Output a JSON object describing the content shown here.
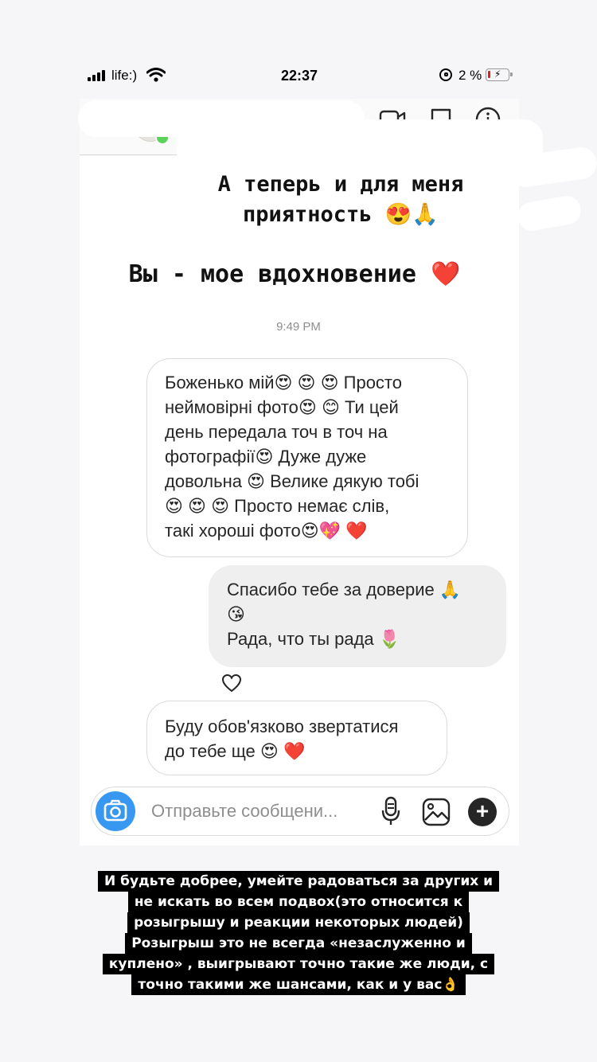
{
  "status_bar": {
    "carrier": "life:)",
    "time": "22:37",
    "battery": "2 %"
  },
  "story": {
    "top_line1": "А теперь и для меня",
    "top_line2": "приятность 😍🙏",
    "top_line3": "Вы - мое вдохновение ❤️"
  },
  "chat": {
    "timestamp": "9:49 PM",
    "messages": [
      {
        "from": "them",
        "lines": [
          "Боженько мій😍 😍 😍 Просто",
          "неймовірні фото😍 😊 Ти цей",
          "день передала точ в точ на",
          "фотографії😍 Дуже дуже",
          "довольна 😍 Велике дякую тобі",
          "😍 😍 😍 Просто немає слів,",
          "такі хороші фото😍💖 ❤️"
        ]
      },
      {
        "from": "me",
        "lines": [
          "Спасибо тебе за доверие 🙏",
          "😘",
          "Рада, что ты рада 🌷"
        ]
      },
      {
        "from": "them",
        "lines": [
          "Буду обов'язково звертатися",
          "до тебе ще 😍 ❤️"
        ]
      }
    ],
    "composer": {
      "placeholder": "Отправьте сообщени..."
    }
  },
  "caption": {
    "lines": [
      "И будьте добрее, умейте радоваться за других и",
      "не искать во всем подвох(это относится к",
      "розыгрышу и реакции некоторых людей)",
      "Розыгрыш это не всегда «незаслуженно и",
      "куплено» , выигрывают точно такие же люди, с",
      "точно такими же шансами, как и у вас👌"
    ]
  },
  "colors": {
    "accent_blue": "#3897f0",
    "online_green": "#5bd35b",
    "bubble_mine": "#efefef"
  },
  "icons": [
    "signal-icon",
    "wifi-icon",
    "rotation-lock-icon",
    "battery-icon",
    "video-call-icon",
    "flag-icon",
    "info-icon",
    "heart-icon",
    "camera-icon",
    "microphone-icon",
    "gallery-icon",
    "plus-icon"
  ]
}
